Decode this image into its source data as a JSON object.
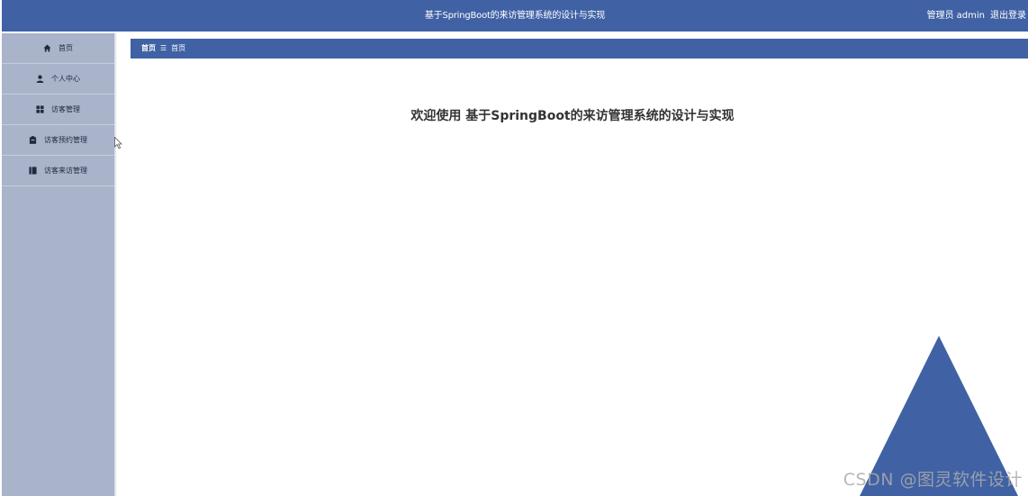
{
  "header": {
    "title": "基于SpringBoot的来访管理系统的设计与实现",
    "role": "管理员",
    "username": "admin",
    "logout": "退出登录"
  },
  "sidebar": {
    "items": [
      {
        "label": "首页",
        "icon": "home-icon"
      },
      {
        "label": "个人中心",
        "icon": "user-icon"
      },
      {
        "label": "访客管理",
        "icon": "grid-icon"
      },
      {
        "label": "访客预约管理",
        "icon": "clipboard-icon"
      },
      {
        "label": "访客来访管理",
        "icon": "book-icon"
      }
    ]
  },
  "breadcrumb": {
    "root": "首页",
    "separator": "☰",
    "current": "首页"
  },
  "main": {
    "welcome": "欢迎使用 基于SpringBoot的来访管理系统的设计与实现"
  },
  "watermark": "CSDN @图灵软件设计",
  "colors": {
    "primary": "#4062a4",
    "sidebar": "#a9b4cb"
  }
}
